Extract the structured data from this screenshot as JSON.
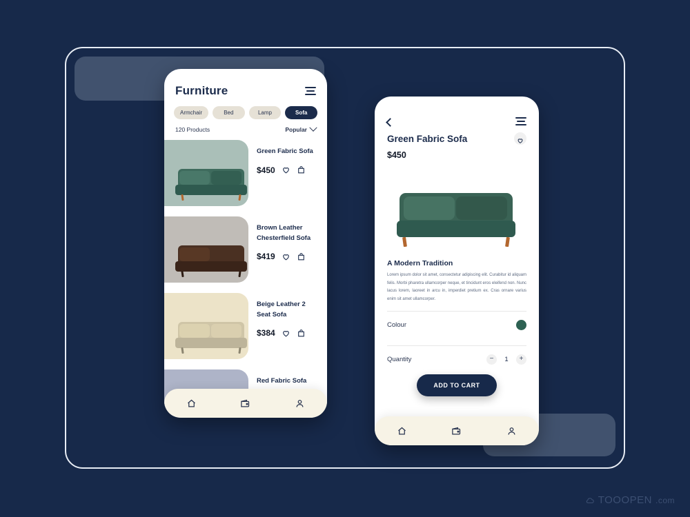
{
  "theme": {
    "background": "#17294a",
    "accent_navy": "#1b2b4b",
    "chip_beige": "#e6e1d6",
    "nav_cream": "#f7f3e6",
    "green": "#2d6152"
  },
  "list_screen": {
    "title": "Furniture",
    "menu_icon": "hamburger-icon",
    "categories": [
      {
        "label": "Armchair",
        "active": false
      },
      {
        "label": "Bed",
        "active": false
      },
      {
        "label": "Lamp",
        "active": false
      },
      {
        "label": "Sofa",
        "active": true
      }
    ],
    "count_label": "120 Products",
    "sort_label": "Popular",
    "products": [
      {
        "name": "Green Fabric Sofa",
        "price": "$450",
        "tile": "#aabfb8",
        "body": "#2f5a4f",
        "cushion": "#3e6b5d"
      },
      {
        "name": "Brown Leather Chesterfield Sofa",
        "price": "$419",
        "tile": "#c0bcb7",
        "body": "#40291d",
        "cushion": "#5b3a26"
      },
      {
        "name": "Beige Leather 2 Seat Sofa",
        "price": "$384",
        "tile": "#ece3c8",
        "body": "#bdb49a",
        "cushion": "#ded3b2"
      },
      {
        "name": "Red Fabric Sofa",
        "price": "",
        "tile": "#aeb4c8",
        "body": "#8d4550",
        "cushion": "#a3545f"
      }
    ],
    "bottom_nav": [
      {
        "icon": "home-icon",
        "label": "Home"
      },
      {
        "icon": "wallet-icon",
        "label": "Wallet"
      },
      {
        "icon": "user-icon",
        "label": "Profile"
      }
    ]
  },
  "detail_screen": {
    "back_icon": "back-chevron-icon",
    "menu_icon": "hamburger-icon",
    "favorite_icon": "heart-icon",
    "title": "Green Fabric Sofa",
    "price": "$450",
    "section_title": "A Modern Tradition",
    "description": "Lorem ipsum dolor sit amet, consectetur adipiscing elit. Curabitur id aliquam felis. Morbi pharetra ullamcorper neque, et tincidunt eros eleifend non. Nunc lacus lorem, laoreet in arcu in, imperdiet pretium ex. Cras ornare varius enim sit amet ullamcorper.",
    "colour_label": "Colour",
    "colour_value": "#2d6152",
    "quantity_label": "Quantity",
    "quantity_value": "1",
    "quantity_minus": "−",
    "quantity_plus": "+",
    "cart_button": "ADD TO CART",
    "bottom_nav": [
      {
        "icon": "home-icon",
        "label": "Home"
      },
      {
        "icon": "wallet-icon",
        "label": "Wallet"
      },
      {
        "icon": "user-icon",
        "label": "Profile"
      }
    ]
  },
  "watermark": {
    "brand": "TOOOPEN",
    "suffix": ".com",
    "icon": "cloud-icon"
  }
}
